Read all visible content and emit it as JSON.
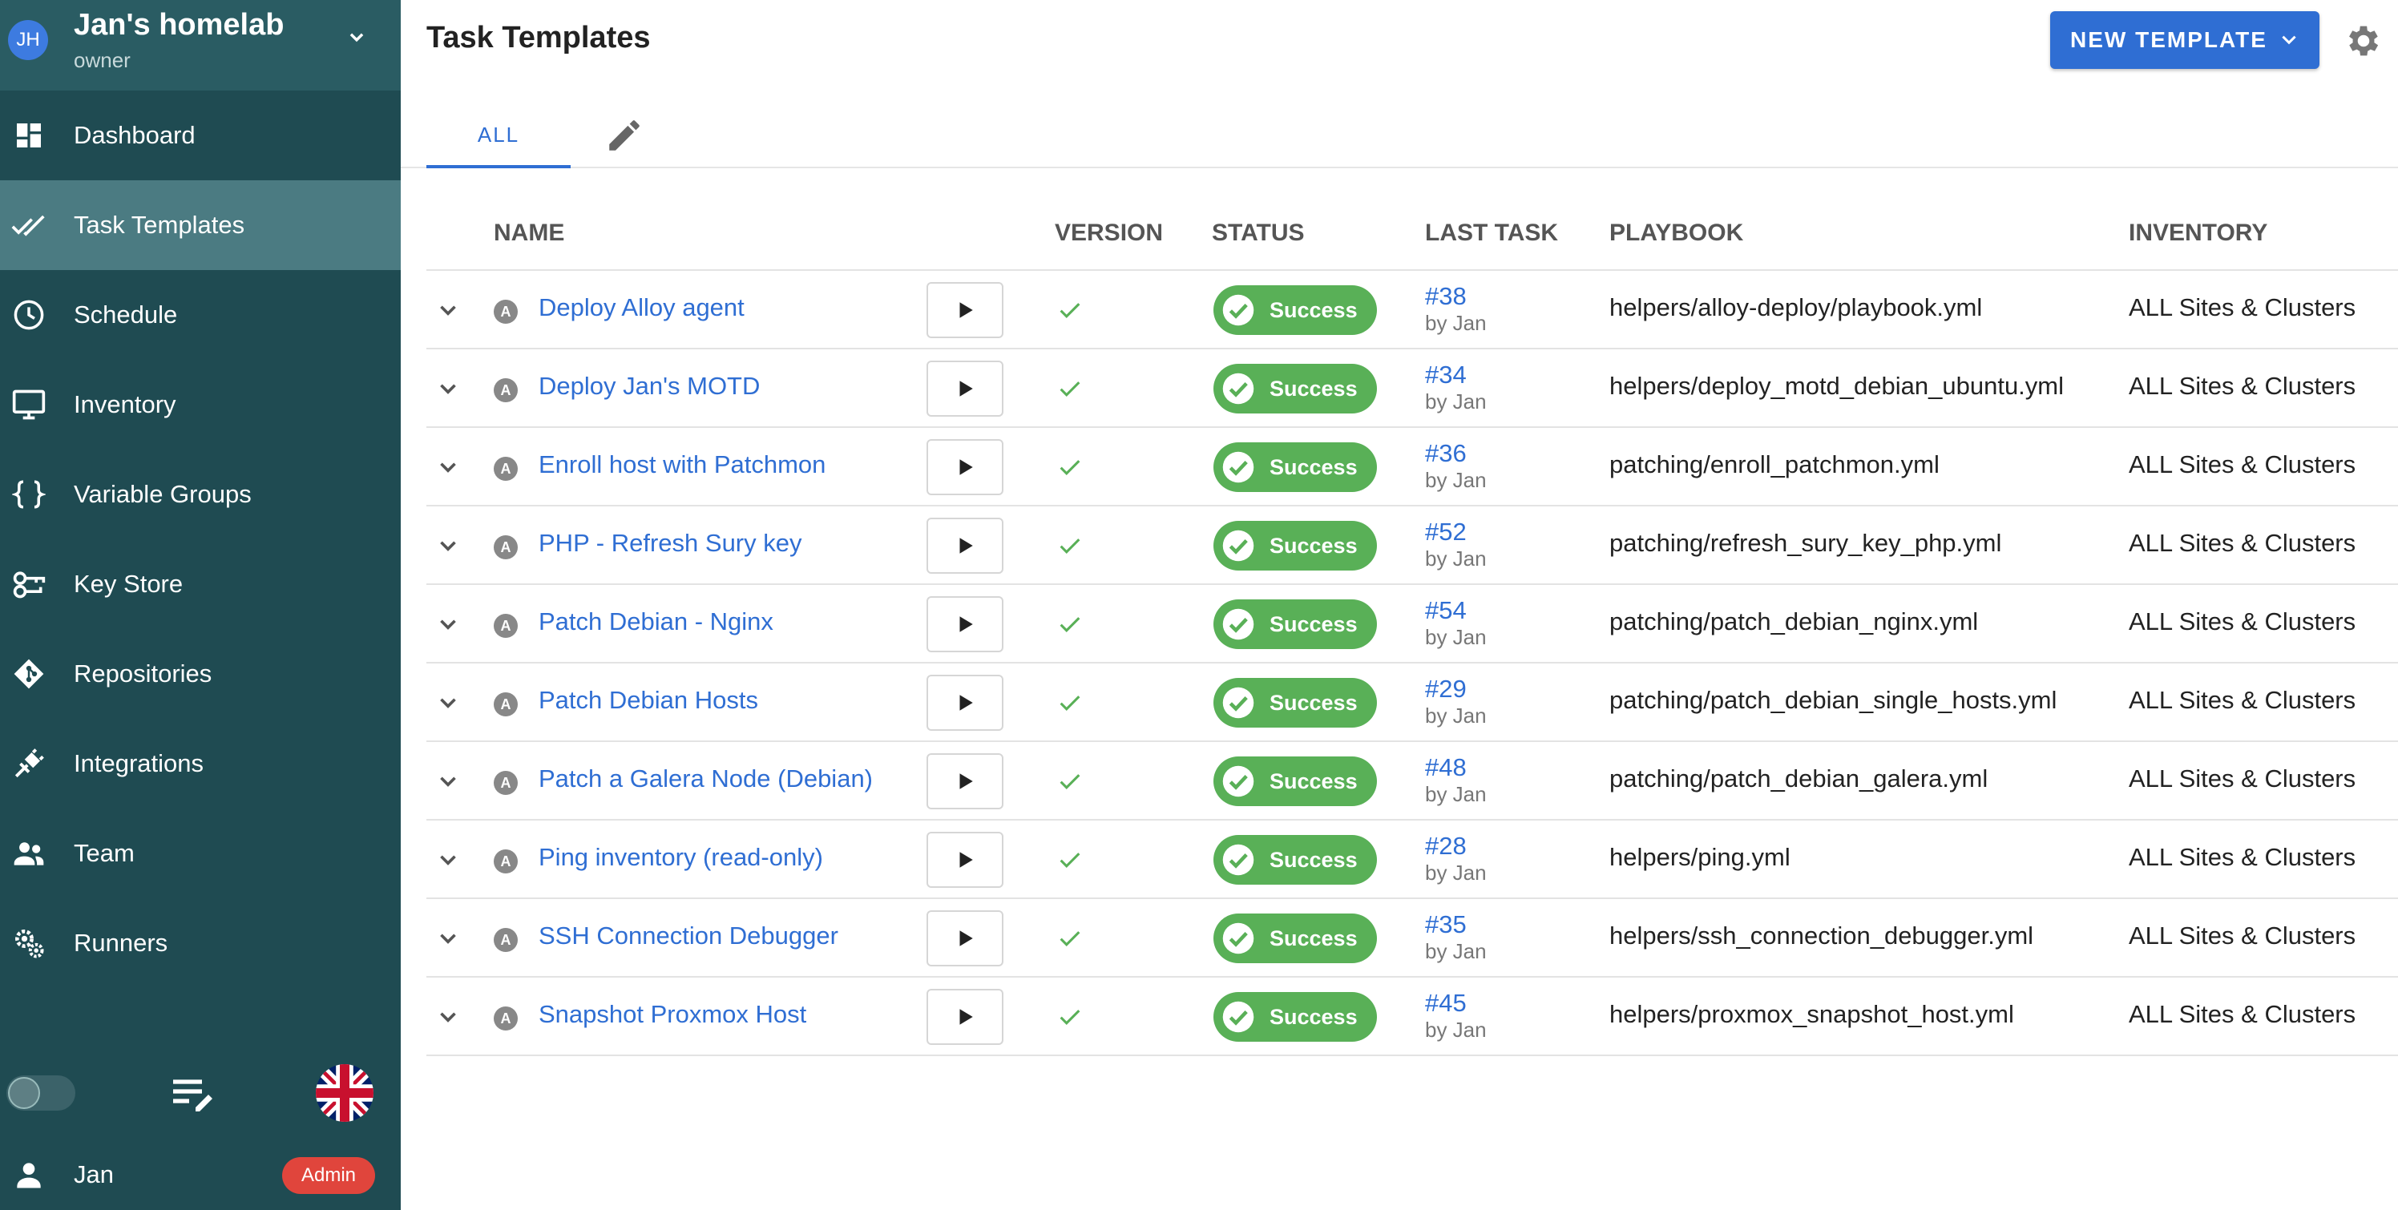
{
  "project": {
    "avatar_initials": "JH",
    "name": "Jan's homelab",
    "role": "owner"
  },
  "nav": [
    {
      "label": "Dashboard",
      "icon": "dashboard-icon"
    },
    {
      "label": "Task Templates",
      "icon": "double-check-icon",
      "active": true
    },
    {
      "label": "Schedule",
      "icon": "clock-icon"
    },
    {
      "label": "Inventory",
      "icon": "monitor-icon"
    },
    {
      "label": "Variable Groups",
      "icon": "braces-icon"
    },
    {
      "label": "Key Store",
      "icon": "key-icon"
    },
    {
      "label": "Repositories",
      "icon": "git-icon"
    },
    {
      "label": "Integrations",
      "icon": "plug-icon"
    },
    {
      "label": "Team",
      "icon": "team-icon"
    },
    {
      "label": "Runners",
      "icon": "gears-icon"
    }
  ],
  "user": {
    "name": "Jan",
    "badge": "Admin"
  },
  "header": {
    "title": "Task Templates",
    "new_button": "NEW TEMPLATE"
  },
  "tabs": {
    "all": "ALL"
  },
  "columns": {
    "name": "NAME",
    "version": "VERSION",
    "status": "STATUS",
    "last_task": "LAST TASK",
    "playbook": "PLAYBOOK",
    "inventory": "INVENTORY"
  },
  "app_badge": "A",
  "templates": [
    {
      "name": "Deploy Alloy agent",
      "status": "Success",
      "task": "#38",
      "by": "by Jan",
      "playbook": "helpers/alloy-deploy/playbook.yml",
      "inventory": "ALL Sites & Clusters"
    },
    {
      "name": "Deploy Jan's MOTD",
      "status": "Success",
      "task": "#34",
      "by": "by Jan",
      "playbook": "helpers/deploy_motd_debian_ubuntu.yml",
      "inventory": "ALL Sites & Clusters"
    },
    {
      "name": "Enroll host with Patchmon",
      "status": "Success",
      "task": "#36",
      "by": "by Jan",
      "playbook": "patching/enroll_patchmon.yml",
      "inventory": "ALL Sites & Clusters"
    },
    {
      "name": "PHP - Refresh Sury key",
      "status": "Success",
      "task": "#52",
      "by": "by Jan",
      "playbook": "patching/refresh_sury_key_php.yml",
      "inventory": "ALL Sites & Clusters"
    },
    {
      "name": "Patch Debian - Nginx",
      "status": "Success",
      "task": "#54",
      "by": "by Jan",
      "playbook": "patching/patch_debian_nginx.yml",
      "inventory": "ALL Sites & Clusters"
    },
    {
      "name": "Patch Debian Hosts",
      "status": "Success",
      "task": "#29",
      "by": "by Jan",
      "playbook": "patching/patch_debian_single_hosts.yml",
      "inventory": "ALL Sites & Clusters"
    },
    {
      "name": "Patch a Galera Node (Debian)",
      "status": "Success",
      "task": "#48",
      "by": "by Jan",
      "playbook": "patching/patch_debian_galera.yml",
      "inventory": "ALL Sites & Clusters"
    },
    {
      "name": "Ping inventory (read-only)",
      "status": "Success",
      "task": "#28",
      "by": "by Jan",
      "playbook": "helpers/ping.yml",
      "inventory": "ALL Sites & Clusters"
    },
    {
      "name": "SSH Connection Debugger",
      "status": "Success",
      "task": "#35",
      "by": "by Jan",
      "playbook": "helpers/ssh_connection_debugger.yml",
      "inventory": "ALL Sites & Clusters"
    },
    {
      "name": "Snapshot Proxmox Host",
      "status": "Success",
      "task": "#45",
      "by": "by Jan",
      "playbook": "helpers/proxmox_snapshot_host.yml",
      "inventory": "ALL Sites & Clusters"
    }
  ],
  "colors": {
    "sidebar": "#1f4b52",
    "sidebar_active": "#4b7b82",
    "accent": "#2f6ed3",
    "success": "#59b057",
    "admin_badge": "#e0453c"
  }
}
